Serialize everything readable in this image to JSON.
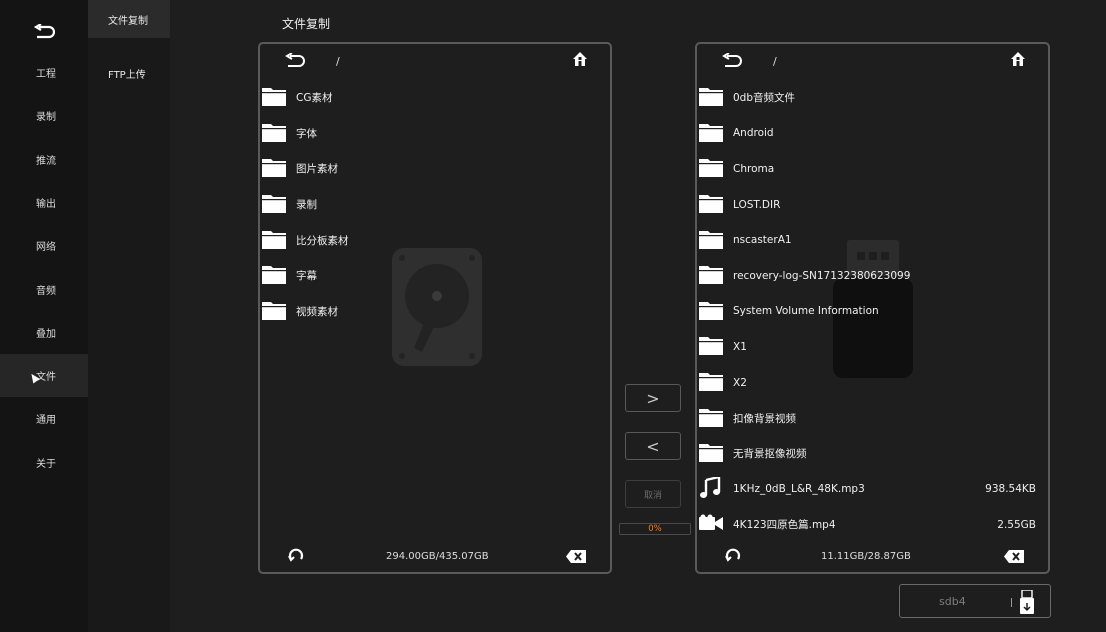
{
  "nav": {
    "items": [
      {
        "label": "工程"
      },
      {
        "label": "录制"
      },
      {
        "label": "推流"
      },
      {
        "label": "输出"
      },
      {
        "label": "网络"
      },
      {
        "label": "音频"
      },
      {
        "label": "叠加"
      },
      {
        "label": "文件",
        "active": true
      },
      {
        "label": "通用"
      },
      {
        "label": "关于"
      }
    ]
  },
  "subnav": {
    "items": [
      {
        "label": "文件复制",
        "active": true
      },
      {
        "label": "FTP上传"
      }
    ]
  },
  "page": {
    "title": "文件复制"
  },
  "left_panel": {
    "path": "/",
    "capacity": "294.00GB/435.07GB",
    "entries": [
      {
        "name": "CG素材",
        "type": "folder"
      },
      {
        "name": "字体",
        "type": "folder"
      },
      {
        "name": "图片素材",
        "type": "folder"
      },
      {
        "name": "录制",
        "type": "folder"
      },
      {
        "name": "比分板素材",
        "type": "folder"
      },
      {
        "name": "字幕",
        "type": "folder"
      },
      {
        "name": "视频素材",
        "type": "folder"
      }
    ]
  },
  "right_panel": {
    "path": "/",
    "capacity": "11.11GB/28.87GB",
    "entries": [
      {
        "name": "0db音频文件",
        "type": "folder"
      },
      {
        "name": "Android",
        "type": "folder"
      },
      {
        "name": "Chroma",
        "type": "folder"
      },
      {
        "name": "LOST.DIR",
        "type": "folder"
      },
      {
        "name": "nscasterA1",
        "type": "folder"
      },
      {
        "name": "recovery-log-SN17132380623099",
        "type": "folder"
      },
      {
        "name": "System Volume Information",
        "type": "folder"
      },
      {
        "name": "X1",
        "type": "folder"
      },
      {
        "name": "X2",
        "type": "folder"
      },
      {
        "name": "扣像背景视频",
        "type": "folder"
      },
      {
        "name": "无背景抠像视频",
        "type": "folder"
      },
      {
        "name": "1KHz_0dB_L&R_48K.mp3",
        "type": "audio",
        "size": "938.54KB"
      },
      {
        "name": "4K123四原色篇.mp4",
        "type": "video",
        "size": "2.55GB"
      }
    ]
  },
  "controls": {
    "copy_right": ">",
    "copy_left": "<",
    "cancel": "取消",
    "progress": "0%"
  },
  "device": {
    "name": "sdb4"
  },
  "colors": {
    "accent_progress": "#ff7a1a",
    "border": "#5a5a5a",
    "background": "#1e1e1e"
  },
  "icons": [
    "back-icon",
    "home-icon",
    "folder-icon",
    "music-note-icon",
    "video-camera-icon",
    "refresh-icon",
    "delete-icon",
    "hard-drive-icon",
    "usb-drive-icon"
  ]
}
